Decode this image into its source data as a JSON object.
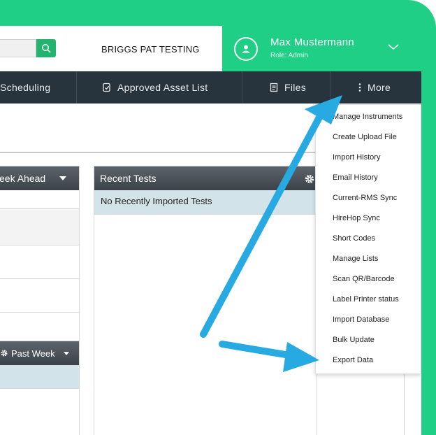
{
  "header": {
    "company_name": "BRIGGS PAT TESTING",
    "user_name": "Max Mustermann",
    "user_role": "Role: Admin"
  },
  "nav": {
    "scheduling": "Scheduling",
    "approved_asset_list": "Approved Asset List",
    "files": "Files",
    "more": "More"
  },
  "panels": {
    "schedule_filter": "eek Ahead",
    "recent_tests_title": "Recent Tests",
    "recent_tests_empty": "No Recently Imported Tests",
    "past_week_filter": "Past Week"
  },
  "more_menu": {
    "items": [
      "Manage Instruments",
      "Create Upload File",
      "Import History",
      "Email History",
      "Current-RMS Sync",
      "HireHop Sync",
      "Short Codes",
      "Manage Lists",
      "Scan QR/Barcode",
      "Label Printer status",
      "Import Database",
      "Bulk Update",
      "Export Data"
    ]
  },
  "colors": {
    "brand_green": "#1fcf86",
    "nav_dark": "#27333d",
    "arrow_blue": "#27a9e1"
  }
}
